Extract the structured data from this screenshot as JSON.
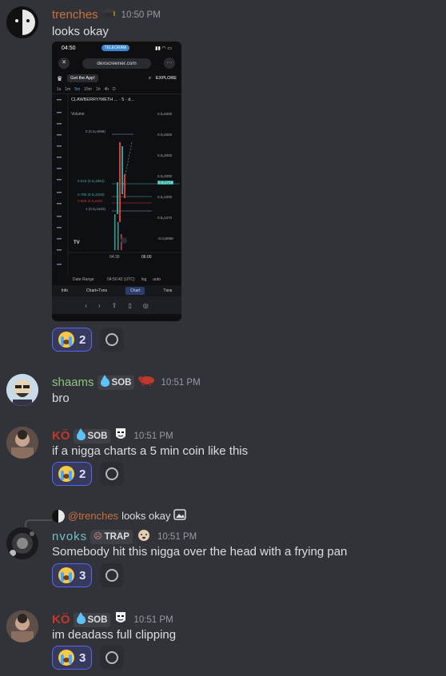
{
  "messages": [
    {
      "username": "trenches",
      "username_color": "#c9713d",
      "badge_icon": "graduation-cap-icon",
      "time": "10:50 PM",
      "text": "looks okay",
      "reaction_count": "2"
    },
    {
      "username": "shaams",
      "username_color": "#8fc57e",
      "tag": "SOB",
      "badge_icon": "cow-icon",
      "time": "10:51 PM",
      "text": "bro"
    },
    {
      "username": "KÖ",
      "username_color": "#c0392b",
      "tag": "SOB",
      "badge_icon": "mask-icon",
      "time": "10:51 PM",
      "text": "if a nigga charts a 5 min coin like this",
      "reaction_count": "2"
    },
    {
      "reply_user": "@trenches",
      "reply_text": "looks okay",
      "username": "nvoks",
      "username_color": "#6fc1c7",
      "tag": "TRAP",
      "badge_icon": "dog-icon",
      "time": "10:51 PM",
      "text": "Somebody hit this nigga over the head with a frying pan",
      "reaction_count": "3"
    },
    {
      "username": "KÖ",
      "username_color": "#c0392b",
      "tag": "SOB",
      "badge_icon": "mask-icon",
      "time": "10:51 PM",
      "text": "im deadass full clipping",
      "reaction_count": "3"
    }
  ],
  "screenshot": {
    "status_time": "04:50",
    "telegram_label": "TELEGRAM",
    "url": "dexscreener.com",
    "get_app": "Get the App!",
    "explore": "EXPLORE",
    "timeframes": [
      "1s",
      "1m",
      "5m",
      "15m",
      "1h",
      "4h",
      "D"
    ],
    "active_timeframe": "5m",
    "pair": "CLAWBERRY/WETH ... · 5 · d...",
    "volume_label": "Volume",
    "price_labels": [
      "0.0₆5000",
      "0.0₆4000",
      "0.0₆3000",
      "0.0₆2000",
      "0.0₆1000",
      "0.0₆1270",
      "-0.0₆9999"
    ],
    "current_price": "0.0₆1719",
    "fib_labels": [
      "0 (0.0₆4098)",
      "0.618 (0.0₆1884)",
      "0.786 (0.0₆1026)",
      "0.886 (0.0₆849)",
      "1 (0.0₆1620)"
    ],
    "time_labels": [
      "04:30",
      "06:00"
    ],
    "date_range": "Date Range",
    "clock": "04:50:42 (UTC)",
    "log": "log",
    "auto": "auto",
    "tabs": [
      "Info",
      "Chart+Txns",
      "Chart",
      "Txns"
    ],
    "active_tab": "Chart"
  },
  "colors": {
    "background": "#323339",
    "reaction_bg": "#373a5c",
    "reaction_border": "#5865f2"
  }
}
